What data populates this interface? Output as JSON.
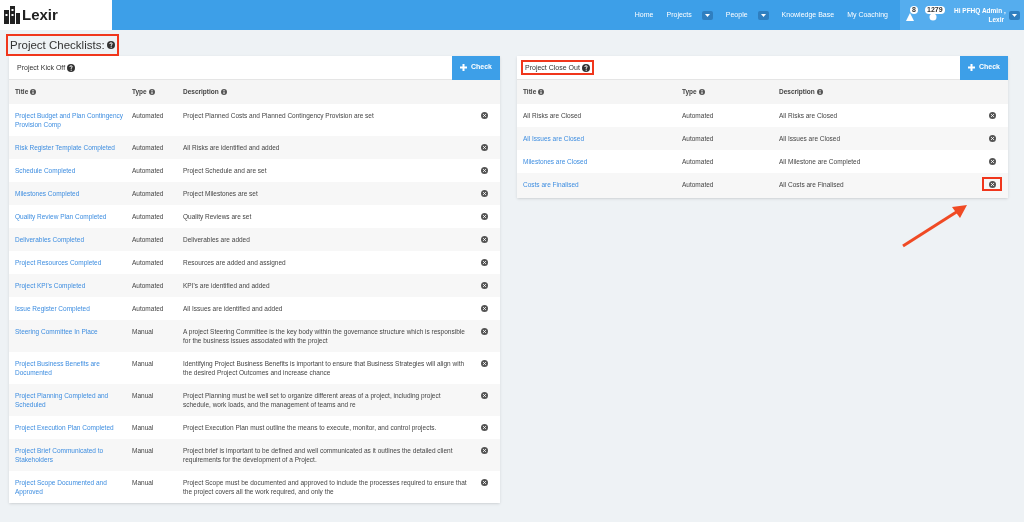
{
  "nav": {
    "logo": "Lexir",
    "items": [
      {
        "label": "Home",
        "dropdown": false
      },
      {
        "label": "Projects",
        "dropdown": true
      },
      {
        "label": "People",
        "dropdown": true
      },
      {
        "label": "Knowledge Base",
        "dropdown": false
      },
      {
        "label": "My Coaching",
        "dropdown": false
      }
    ],
    "alerts_count": "8",
    "messages_count": "1279",
    "user": "Hi PFHQ Admin ,\nLexir"
  },
  "page_title": {
    "text": "Project Checklists:",
    "highlighted": true
  },
  "panels": [
    {
      "title": "Project Kick Off",
      "highlighted": false,
      "add_button": "Check",
      "columns": [
        "Title",
        "Type",
        "Description"
      ],
      "rows": [
        {
          "title": "Project Budget and Plan Contingency Provision Comp",
          "link": true,
          "type": "Automated",
          "description": "Project Planned Costs and Planned Contingency Provision are set",
          "highlighted": false
        },
        {
          "title": "Risk Register Template Completed",
          "link": true,
          "type": "Automated",
          "description": "All Risks are identified and added",
          "highlighted": false
        },
        {
          "title": "Schedule Completed",
          "link": true,
          "type": "Automated",
          "description": "Project Schedule and are set",
          "highlighted": false
        },
        {
          "title": "Milestones Completed",
          "link": true,
          "type": "Automated",
          "description": "Project Milestones are set",
          "highlighted": false
        },
        {
          "title": "Quality Review Plan Completed",
          "link": true,
          "type": "Automated",
          "description": "Quality Reviews are set",
          "highlighted": false
        },
        {
          "title": "Deliverables Completed",
          "link": true,
          "type": "Automated",
          "description": "Deliverables are added",
          "highlighted": false
        },
        {
          "title": "Project Resources Completed",
          "link": true,
          "type": "Automated",
          "description": "Resources are added and assigned",
          "highlighted": false
        },
        {
          "title": "Project KPI's Completed",
          "link": true,
          "type": "Automated",
          "description": "KPI's are identified and added",
          "highlighted": false
        },
        {
          "title": "Issue Register Completed",
          "link": true,
          "type": "Automated",
          "description": "All Issues are identified and added",
          "highlighted": false
        },
        {
          "title": "Steering Committee In Place",
          "link": true,
          "type": "Manual",
          "description": "A project Steering Committee is the key body within the governance structure which is responsible for the business issues associated with the project",
          "highlighted": false
        },
        {
          "title": "Project Business Benefits are Documented",
          "link": true,
          "type": "Manual",
          "description": "Identifying Project Business Benefits is important to ensure that Business Strategies will align with the desired Project Outcomes and increase chance",
          "highlighted": false
        },
        {
          "title": "Project Planning Completed and Scheduled",
          "link": true,
          "type": "Manual",
          "description": "Project Planning must be well set to organize different areas of a project, including project schedule, work loads, and the management of teams and re",
          "highlighted": false
        },
        {
          "title": "Project Execution Plan Completed",
          "link": true,
          "type": "Manual",
          "description": "Project Execution Plan must outline the means to execute, monitor, and control projects.",
          "highlighted": false
        },
        {
          "title": "Project Brief Communicated to Stakeholders",
          "link": true,
          "type": "Manual",
          "description": "Project brief is important to be defined and well communicated as it outlines the detailed client requirements for the development of a Project.",
          "highlighted": false
        },
        {
          "title": "Project Scope Documented and Approved",
          "link": true,
          "type": "Manual",
          "description": "Project Scope must be documented and approved to include the processes required to ensure that the project covers all the work required, and only the",
          "highlighted": false
        }
      ]
    },
    {
      "title": "Project Close Out",
      "highlighted": true,
      "add_button": "Check",
      "columns": [
        "Title",
        "Type",
        "Description"
      ],
      "rows": [
        {
          "title": "All Risks are Closed",
          "link": false,
          "type": "Automated",
          "description": "All Risks are Closed",
          "highlighted": false
        },
        {
          "title": "All Issues are Closed",
          "link": true,
          "type": "Automated",
          "description": "All Issues are Closed",
          "highlighted": false
        },
        {
          "title": "Milestones are Closed",
          "link": true,
          "type": "Automated",
          "description": "All Milestone are Completed",
          "highlighted": false
        },
        {
          "title": "Costs are Finalised",
          "link": true,
          "type": "Automated",
          "description": "All Costs are Finalised",
          "highlighted": true
        }
      ]
    }
  ]
}
